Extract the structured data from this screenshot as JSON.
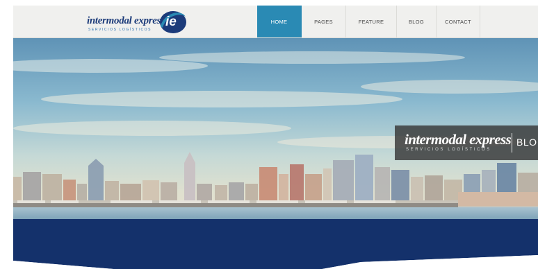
{
  "brand": {
    "name": "intermodal express",
    "tagline": "SERVICIOS LOGÍSTICOS",
    "badge": "ie"
  },
  "nav": {
    "items": [
      {
        "label": "HOME",
        "active": true
      },
      {
        "label": "PAGES",
        "active": false
      },
      {
        "label": "FEATURE",
        "active": false
      },
      {
        "label": "BLOG",
        "active": false
      },
      {
        "label": "CONTACT",
        "active": false
      }
    ]
  },
  "hero": {
    "image": "city-skyline-waterfront",
    "card": {
      "name": "intermodal express",
      "tagline": "SERVICIOS LOGÍSTICOS",
      "label": "BLO"
    }
  },
  "colors": {
    "accent": "#2a8ab4",
    "brand_navy": "#1c3b7a",
    "band_navy": "#14316b",
    "header_bg": "#f0f0ee"
  }
}
